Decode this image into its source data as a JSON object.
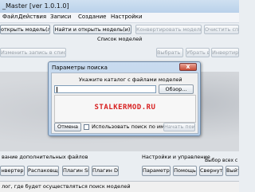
{
  "window": {
    "title": "_Master [ver 1.0.1.0]"
  },
  "menu": [
    "Файл",
    "Действия",
    "Записи",
    "Создание",
    "Настройки"
  ],
  "toolbar": {
    "open_models": "открыть модель(ли)",
    "find_open": "Найти и открыть модель(и)",
    "convert": "Конвертировать модель(ли)",
    "clear_list": "Очистить спис"
  },
  "models_list_label": "Список моделей",
  "list_actions": {
    "change": "Изменить запись в списке",
    "select_all": "Выбрать всё",
    "remove_all": "Убрать всё",
    "invert": "Инвертировать"
  },
  "dialog": {
    "title": "Параметры поиска",
    "close": "x",
    "prompt": "Укажите каталог с файлами моделей",
    "browse": "Обзор...",
    "path_value": "",
    "logo": "STALKERMOD.RU",
    "checkbox_label": "Использовать поиск по имени",
    "checkbox_checked": false,
    "cancel": "Отмена",
    "start": "Начать поиск"
  },
  "left_label": "вание дополнительных файлов",
  "right_label": "Настройки и управление",
  "right_label2": "Выбор всех с",
  "bottom_buttons": [
    "нвертер",
    "Распаковщик",
    "Плагин SMD",
    "Плагин DDS",
    "Параметры",
    "Помощь",
    "Свернуть",
    "Выйти"
  ],
  "status": "лог, где будет осуществляться поиск моделей"
}
